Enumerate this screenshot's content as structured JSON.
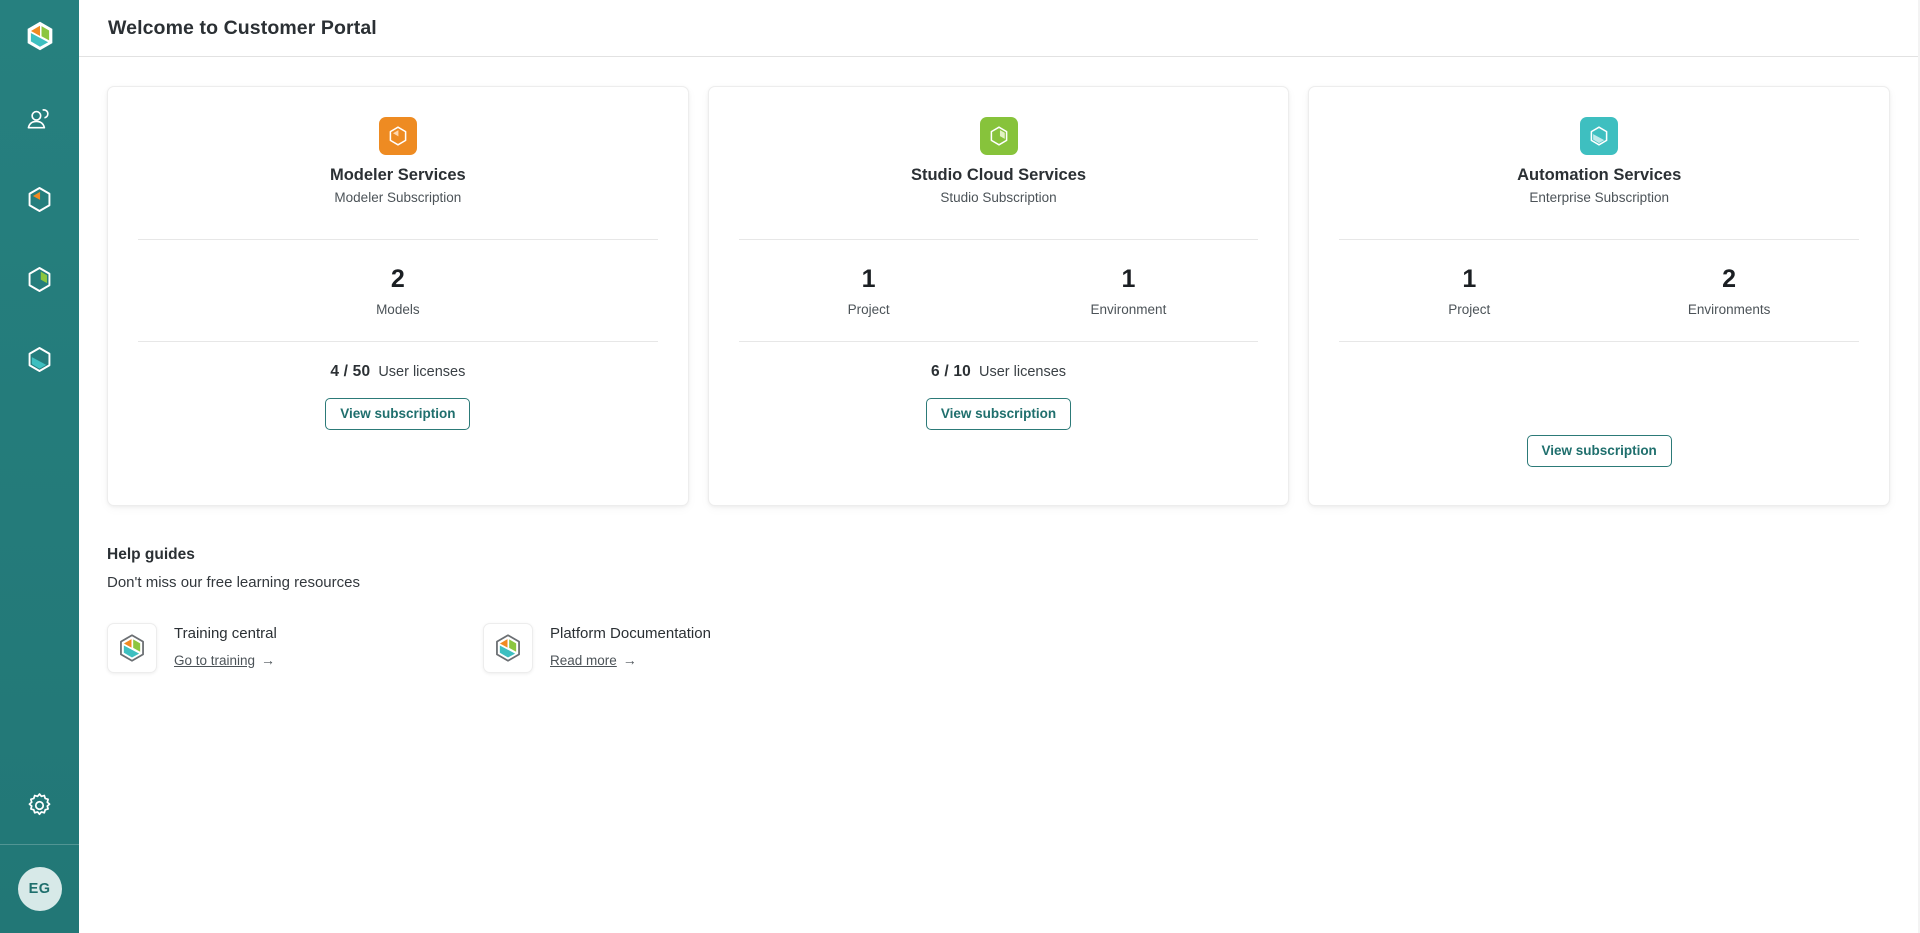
{
  "colors": {
    "sidebar_bg": "#237a7a",
    "accent_teal": "#1f6f6d",
    "orange": "#ee8b22",
    "green": "#87c33b",
    "cyan": "#3ebfc0"
  },
  "sidebar": {
    "logo_icon": "cube-logo-icon",
    "items": [
      {
        "icon": "users-icon",
        "name": "sidebar-item-users"
      },
      {
        "icon": "cube-orange-icon",
        "name": "sidebar-item-modeler"
      },
      {
        "icon": "cube-green-icon",
        "name": "sidebar-item-studio"
      },
      {
        "icon": "cube-cyan-icon",
        "name": "sidebar-item-automation"
      }
    ],
    "settings_icon": "gear-icon",
    "avatar_initials": "EG"
  },
  "header": {
    "title": "Welcome to Customer Portal"
  },
  "cards": [
    {
      "icon": "cube-orange-icon",
      "icon_color": "#ee8b22",
      "title": "Modeler Services",
      "subtitle": "Modeler Subscription",
      "metrics": [
        {
          "value": "2",
          "label": "Models"
        }
      ],
      "licenses": {
        "count": "4 / 50",
        "label": "User licenses"
      },
      "button": "View subscription"
    },
    {
      "icon": "cube-green-icon",
      "icon_color": "#87c33b",
      "title": "Studio Cloud Services",
      "subtitle": "Studio Subscription",
      "metrics": [
        {
          "value": "1",
          "label": "Project"
        },
        {
          "value": "1",
          "label": "Environment"
        }
      ],
      "licenses": {
        "count": "6 / 10",
        "label": "User licenses"
      },
      "button": "View subscription"
    },
    {
      "icon": "cube-cyan-icon",
      "icon_color": "#3ebfc0",
      "title": "Automation Services",
      "subtitle": "Enterprise Subscription",
      "metrics": [
        {
          "value": "1",
          "label": "Project"
        },
        {
          "value": "2",
          "label": "Environments"
        }
      ],
      "licenses": null,
      "button": "View subscription"
    }
  ],
  "help": {
    "title": "Help guides",
    "subtitle": "Don't miss our free learning resources",
    "items": [
      {
        "icon": "cube-logo-icon",
        "name": "Training central",
        "link_label": "Go to training",
        "link_arrow": "→"
      },
      {
        "icon": "cube-logo-icon",
        "name": "Platform Documentation",
        "link_label": "Read more",
        "link_arrow": "→"
      }
    ]
  }
}
